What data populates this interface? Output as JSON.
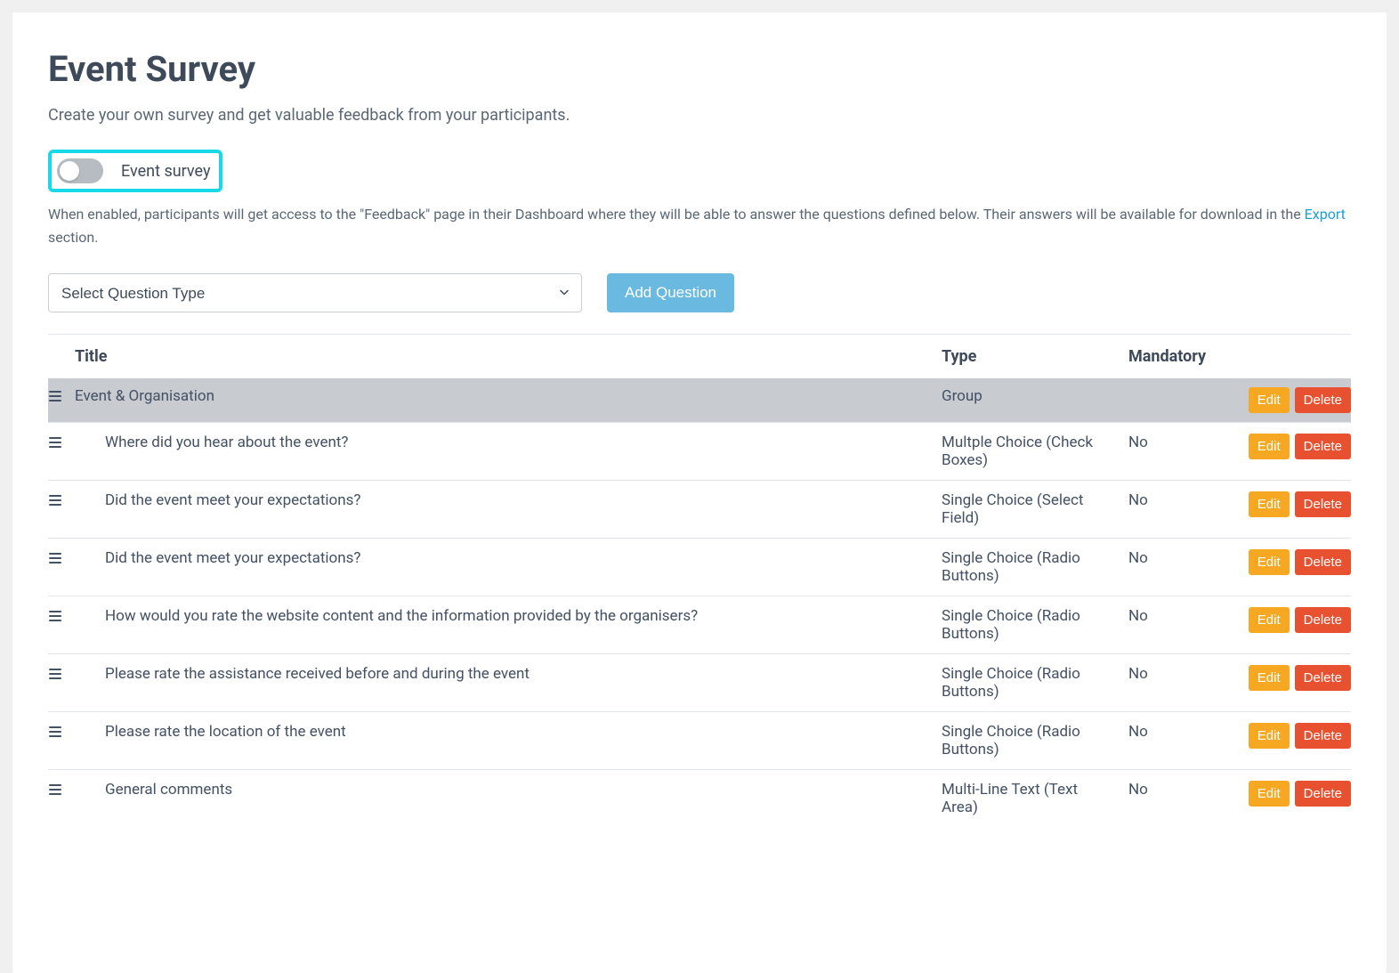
{
  "page": {
    "title": "Event Survey",
    "subtitle": "Create your own survey and get valuable feedback from your participants."
  },
  "toggle": {
    "label": "Event survey",
    "enabled": false
  },
  "help": {
    "prefix": "When enabled, participants will get access to the \"Feedback\" page in their Dashboard where they will be able to answer the questions defined below. Their answers will be available for download in the ",
    "link_text": "Export",
    "suffix": " section."
  },
  "controls": {
    "select_placeholder": "Select Question Type",
    "add_button": "Add Question"
  },
  "table": {
    "headers": {
      "title": "Title",
      "type": "Type",
      "mandatory": "Mandatory"
    },
    "actions": {
      "edit": "Edit",
      "delete": "Delete"
    },
    "rows": [
      {
        "title": "Event & Organisation",
        "type": "Group",
        "mandatory": "",
        "is_group": true
      },
      {
        "title": "Where did you hear about the event?",
        "type": "Multple Choice (Check Boxes)",
        "mandatory": "No",
        "is_group": false
      },
      {
        "title": "Did the event meet your expectations?",
        "type": "Single Choice (Select Field)",
        "mandatory": "No",
        "is_group": false
      },
      {
        "title": "Did the event meet your expectations?",
        "type": "Single Choice (Radio Buttons)",
        "mandatory": "No",
        "is_group": false
      },
      {
        "title": "How would you rate the website content and the information provided by the organisers?",
        "type": "Single Choice (Radio Buttons)",
        "mandatory": "No",
        "is_group": false
      },
      {
        "title": "Please rate the assistance received before and during the event",
        "type": "Single Choice (Radio Buttons)",
        "mandatory": "No",
        "is_group": false
      },
      {
        "title": "Please rate the location of the event",
        "type": "Single Choice (Radio Buttons)",
        "mandatory": "No",
        "is_group": false
      },
      {
        "title": "General comments",
        "type": "Multi-Line Text (Text Area)",
        "mandatory": "No",
        "is_group": false
      }
    ]
  }
}
